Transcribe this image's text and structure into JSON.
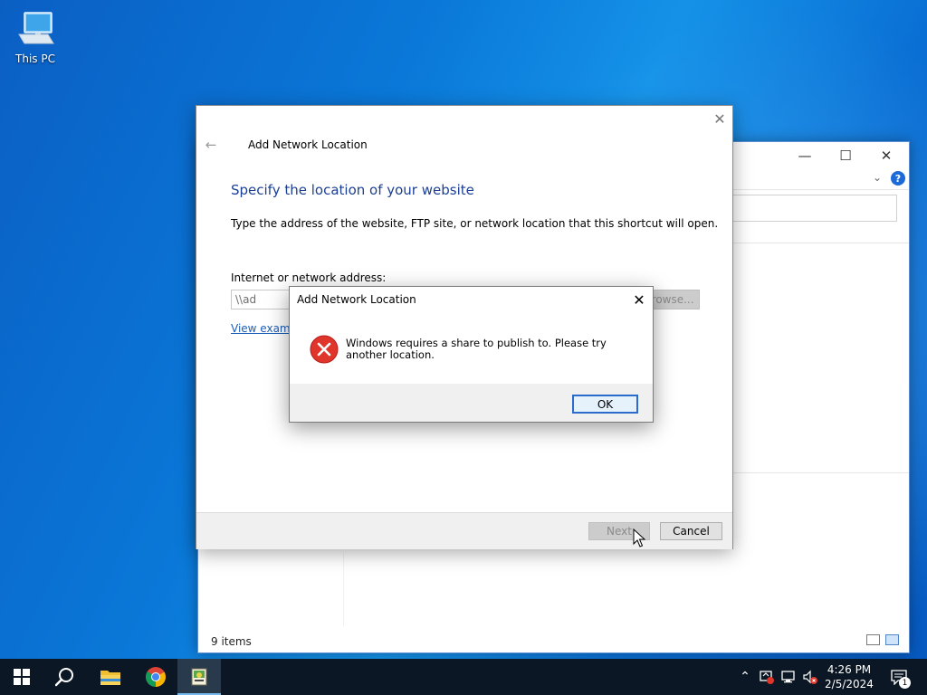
{
  "desktop": {
    "icons": [
      {
        "label": "This PC",
        "icon": "this-pc-icon"
      }
    ]
  },
  "explorer": {
    "status_text": "9 items",
    "controls": {
      "minimize": "—",
      "maximize": "☐",
      "close": "✕"
    },
    "help_label": "?"
  },
  "wizard": {
    "window_title": "Add Network Location",
    "heading": "Specify the location of your website",
    "description": "Type the address of the website, FTP site, or network location that this shortcut will open.",
    "address_label": "Internet or network address:",
    "address_value": "\\\\ad",
    "browse_label": "Browse...",
    "examples_link": "View examples",
    "next_label": "Next",
    "cancel_label": "Cancel"
  },
  "message_box": {
    "title": "Add Network Location",
    "message": "Windows requires a share to publish to.  Please try another location.",
    "ok_label": "OK",
    "icon": "error-icon"
  },
  "taskbar": {
    "items": [
      {
        "name": "start",
        "icon": "windows-logo-icon"
      },
      {
        "name": "search",
        "icon": "search-icon"
      },
      {
        "name": "file-explorer",
        "icon": "folder-icon"
      },
      {
        "name": "chrome",
        "icon": "chrome-icon"
      },
      {
        "name": "network-wizard",
        "icon": "network-location-icon",
        "active": true
      }
    ],
    "clock": {
      "time": "4:26 PM",
      "date": "2/5/2024"
    },
    "notification_count": "1"
  },
  "colors": {
    "heading_blue": "#1c3f94",
    "link_blue": "#1c5fb8",
    "error_red": "#e0352b",
    "taskbar_bg": "#0b1724"
  }
}
